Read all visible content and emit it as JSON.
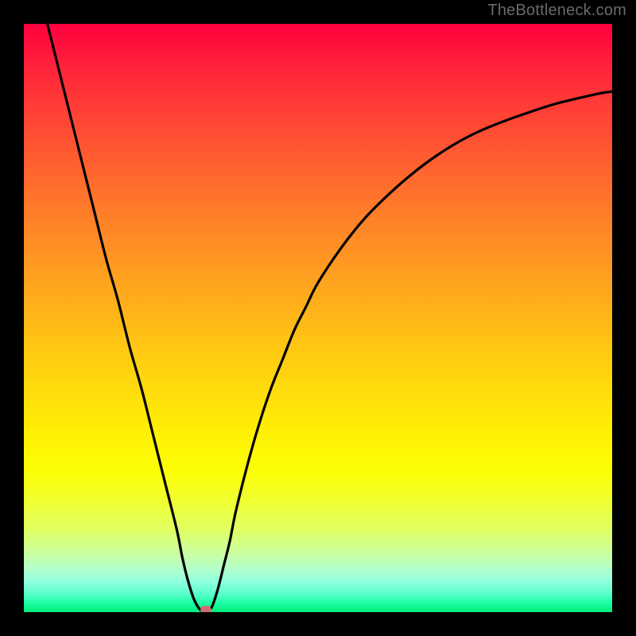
{
  "watermark": "TheBottleneck.com",
  "colors": {
    "frame": "#000000",
    "curve_stroke": "#000000",
    "marker_fill": "#cc6f72",
    "gradient_top": "#ff003e",
    "gradient_bottom": "#00ec7a"
  },
  "chart_data": {
    "type": "line",
    "title": "",
    "xlabel": "",
    "ylabel": "",
    "xlim": [
      0,
      100
    ],
    "ylim": [
      0,
      100
    ],
    "x": [
      4,
      6,
      8,
      10,
      12,
      14,
      16,
      18,
      20,
      22,
      24,
      26,
      27,
      28,
      29,
      30,
      31,
      32,
      33,
      34,
      35,
      36,
      38,
      40,
      42,
      44,
      46,
      48,
      50,
      54,
      58,
      62,
      66,
      70,
      74,
      78,
      82,
      86,
      90,
      94,
      98,
      100
    ],
    "values": [
      100,
      92,
      84,
      76,
      68,
      60,
      53,
      45,
      38,
      30,
      22,
      14,
      9,
      5,
      2,
      0.4,
      0,
      1,
      4,
      8,
      12,
      17,
      25,
      32,
      38,
      43,
      48,
      52,
      56,
      62,
      67,
      71,
      74.5,
      77.5,
      80,
      82,
      83.6,
      85,
      86.3,
      87.3,
      88.2,
      88.5
    ],
    "minimum": {
      "x": 31,
      "y": 0
    }
  }
}
